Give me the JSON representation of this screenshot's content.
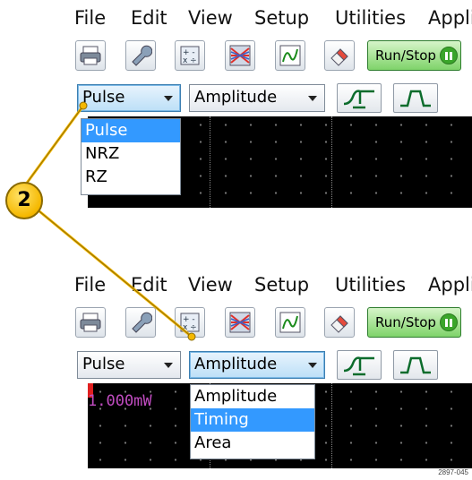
{
  "menu": [
    "File",
    "Edit",
    "View",
    "Setup",
    "Utilities",
    "Applic"
  ],
  "toolbar": {
    "icons": [
      "print-icon",
      "wrench-icon",
      "calculator-icon",
      "waveform-database-icon",
      "autoset-icon",
      "eraser-icon"
    ],
    "run_stop_label": "Run/Stop"
  },
  "top": {
    "combo1_value": "Pulse",
    "combo2_value": "Amplitude",
    "dropdown_options": [
      "Pulse",
      "NRZ",
      "RZ"
    ],
    "dropdown_selected_index": 0
  },
  "bottom": {
    "combo1_value": "Pulse",
    "combo2_value": "Amplitude",
    "dropdown_options": [
      "Amplitude",
      "Timing",
      "Area"
    ],
    "dropdown_selected_index": 1,
    "readout": "1.000mW"
  },
  "callout_number": "2",
  "figure_id": "2897-045",
  "colors": {
    "highlight": "#3399ff",
    "callout": "#f5b800",
    "run_stop": "#7fd36a",
    "readout": "#c04cc0",
    "screen": "#000000"
  }
}
